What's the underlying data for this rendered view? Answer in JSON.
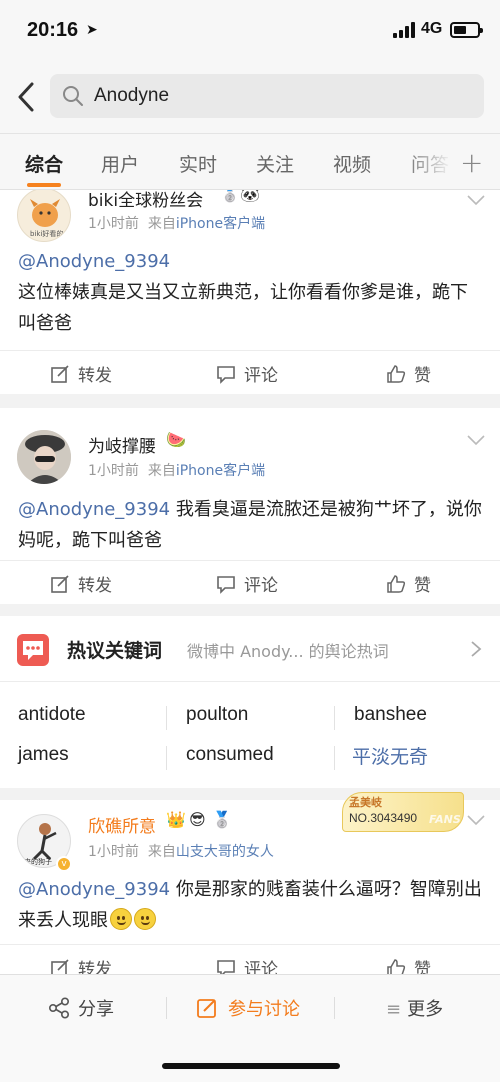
{
  "status": {
    "time": "20:16",
    "network": "4G"
  },
  "search": {
    "query": "Anodyne"
  },
  "tabs": [
    "综合",
    "用户",
    "实时",
    "关注",
    "视频",
    "问答"
  ],
  "posts": [
    {
      "user": "biki全球粉丝会",
      "avatar_text": "biki好看的",
      "time": "1小时前",
      "source_prefix": "来自",
      "source": "iPhone客户端",
      "mention": "@Anodyne_9394",
      "text": "这位棒婊真是又当又立新典范，让你看看你爹是谁，跪下叫爸爸",
      "actions": {
        "repost": "转发",
        "comment": "评论",
        "like": "赞"
      }
    },
    {
      "user": "为岐撑腰",
      "time": "1小时前",
      "source_prefix": "来自",
      "source": "iPhone客户端",
      "mention": "@Anodyne_9394",
      "text": " 我看臭逼是流脓还是被狗艹坏了，说你妈呢，跪下叫爸爸",
      "actions": {
        "repost": "转发",
        "comment": "评论",
        "like": "赞"
      }
    },
    {
      "user": "欣礁所意",
      "avatar_text": "来的狗子",
      "time": "1小时前",
      "source_prefix": "来自",
      "source": "山支大哥的女人",
      "mention": "@Anodyne_9394",
      "text": " 你是那家的贱畜装什么逼呀？智障别出来丢人现眼",
      "badge": {
        "title": "孟美岐",
        "number": "NO.3043490",
        "tag": "FANS"
      },
      "actions": {
        "repost": "转发",
        "comment": "评论",
        "like": "赞"
      }
    }
  ],
  "hot": {
    "title": "热议关键词",
    "subtitle": "微博中 Anody... 的舆论热词",
    "keywords": [
      "antidote",
      "poulton",
      "banshee",
      "james",
      "consumed",
      "平淡无奇"
    ]
  },
  "bottom": {
    "share": "分享",
    "discuss": "参与讨论",
    "more": "更多"
  },
  "colors": {
    "accent": "#f37c1d",
    "link": "#4c6ea8",
    "hot_icon": "#ee5b53"
  }
}
